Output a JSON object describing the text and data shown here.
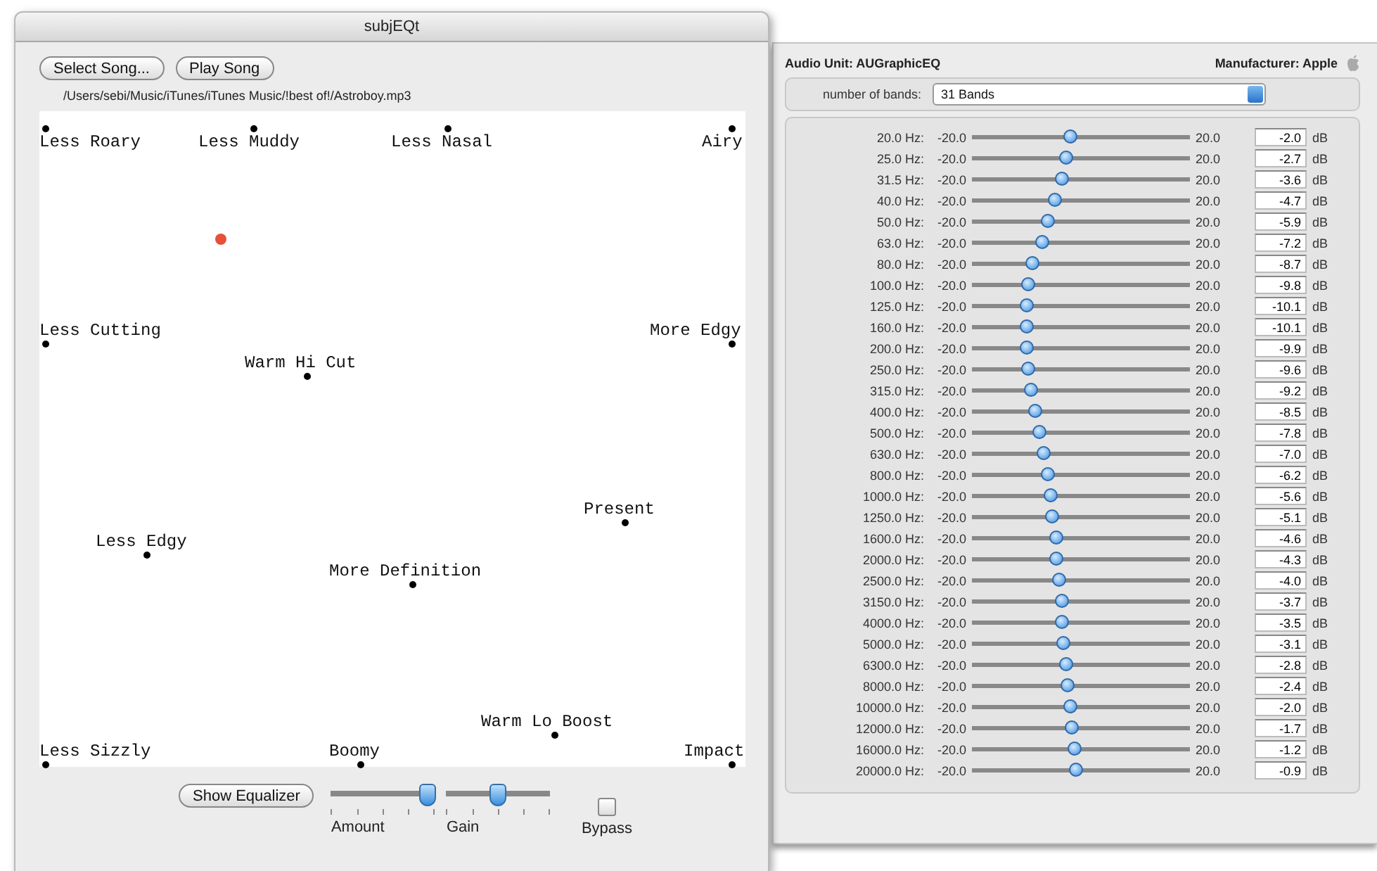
{
  "window": {
    "title": "subjEQt"
  },
  "buttons": [
    "Select Song...",
    "Play Song"
  ],
  "file_path": "/Users/sebi/Music/iTunes/iTunes Music/!best of!/Astroboy.mp3",
  "eq_space": {
    "points": [
      {
        "label": "Less Roary"
      },
      {
        "label": "Less Muddy"
      },
      {
        "label": "Less Nasal"
      },
      {
        "label": "Airy"
      },
      {
        "label": "Less Cutting"
      },
      {
        "label": "More Edgy"
      },
      {
        "label": "Warm Hi Cut"
      },
      {
        "label": "Present"
      },
      {
        "label": "Less Edgy"
      },
      {
        "label": "More Definition"
      },
      {
        "label": "Warm Lo Boost"
      },
      {
        "label": "Less Sizzly"
      },
      {
        "label": "Boomy"
      },
      {
        "label": "Impact"
      }
    ],
    "cursor": {
      "color": "#e8503a"
    }
  },
  "controls": {
    "show_equalizer": "Show Equalizer",
    "sliders": [
      {
        "label": "Amount",
        "level": 0.93
      },
      {
        "label": "Gain",
        "level": 0.5
      }
    ],
    "bypass": {
      "label": "Bypass",
      "checked": false
    }
  },
  "audio_unit": {
    "title": "Audio Unit: AUGraphicEQ",
    "manufacturer": "Manufacturer: Apple",
    "bands_label": "number of bands:",
    "bands_value": "31 Bands",
    "bands": [
      {
        "freq": "20.0 Hz:",
        "min": "-20.0",
        "max": "20.0",
        "value": "-2.0",
        "unit": "dB",
        "level": 0.45
      },
      {
        "freq": "25.0 Hz:",
        "min": "-20.0",
        "max": "20.0",
        "value": "-2.7",
        "unit": "dB",
        "level": 0.43
      },
      {
        "freq": "31.5 Hz:",
        "min": "-20.0",
        "max": "20.0",
        "value": "-3.6",
        "unit": "dB",
        "level": 0.41
      },
      {
        "freq": "40.0 Hz:",
        "min": "-20.0",
        "max": "20.0",
        "value": "-4.7",
        "unit": "dB",
        "level": 0.38
      },
      {
        "freq": "50.0 Hz:",
        "min": "-20.0",
        "max": "20.0",
        "value": "-5.9",
        "unit": "dB",
        "level": 0.35
      },
      {
        "freq": "63.0 Hz:",
        "min": "-20.0",
        "max": "20.0",
        "value": "-7.2",
        "unit": "dB",
        "level": 0.32
      },
      {
        "freq": "80.0 Hz:",
        "min": "-20.0",
        "max": "20.0",
        "value": "-8.7",
        "unit": "dB",
        "level": 0.28
      },
      {
        "freq": "100.0 Hz:",
        "min": "-20.0",
        "max": "20.0",
        "value": "-9.8",
        "unit": "dB",
        "level": 0.26
      },
      {
        "freq": "125.0 Hz:",
        "min": "-20.0",
        "max": "20.0",
        "value": "-10.1",
        "unit": "dB",
        "level": 0.25
      },
      {
        "freq": "160.0 Hz:",
        "min": "-20.0",
        "max": "20.0",
        "value": "-10.1",
        "unit": "dB",
        "level": 0.25
      },
      {
        "freq": "200.0 Hz:",
        "min": "-20.0",
        "max": "20.0",
        "value": "-9.9",
        "unit": "dB",
        "level": 0.25
      },
      {
        "freq": "250.0 Hz:",
        "min": "-20.0",
        "max": "20.0",
        "value": "-9.6",
        "unit": "dB",
        "level": 0.26
      },
      {
        "freq": "315.0 Hz:",
        "min": "-20.0",
        "max": "20.0",
        "value": "-9.2",
        "unit": "dB",
        "level": 0.27
      },
      {
        "freq": "400.0 Hz:",
        "min": "-20.0",
        "max": "20.0",
        "value": "-8.5",
        "unit": "dB",
        "level": 0.29
      },
      {
        "freq": "500.0 Hz:",
        "min": "-20.0",
        "max": "20.0",
        "value": "-7.8",
        "unit": "dB",
        "level": 0.31
      },
      {
        "freq": "630.0 Hz:",
        "min": "-20.0",
        "max": "20.0",
        "value": "-7.0",
        "unit": "dB",
        "level": 0.33
      },
      {
        "freq": "800.0 Hz:",
        "min": "-20.0",
        "max": "20.0",
        "value": "-6.2",
        "unit": "dB",
        "level": 0.35
      },
      {
        "freq": "1000.0 Hz:",
        "min": "-20.0",
        "max": "20.0",
        "value": "-5.6",
        "unit": "dB",
        "level": 0.36
      },
      {
        "freq": "1250.0 Hz:",
        "min": "-20.0",
        "max": "20.0",
        "value": "-5.1",
        "unit": "dB",
        "level": 0.37
      },
      {
        "freq": "1600.0 Hz:",
        "min": "-20.0",
        "max": "20.0",
        "value": "-4.6",
        "unit": "dB",
        "level": 0.39
      },
      {
        "freq": "2000.0 Hz:",
        "min": "-20.0",
        "max": "20.0",
        "value": "-4.3",
        "unit": "dB",
        "level": 0.39
      },
      {
        "freq": "2500.0 Hz:",
        "min": "-20.0",
        "max": "20.0",
        "value": "-4.0",
        "unit": "dB",
        "level": 0.4
      },
      {
        "freq": "3150.0 Hz:",
        "min": "-20.0",
        "max": "20.0",
        "value": "-3.7",
        "unit": "dB",
        "level": 0.41
      },
      {
        "freq": "4000.0 Hz:",
        "min": "-20.0",
        "max": "20.0",
        "value": "-3.5",
        "unit": "dB",
        "level": 0.41
      },
      {
        "freq": "5000.0 Hz:",
        "min": "-20.0",
        "max": "20.0",
        "value": "-3.1",
        "unit": "dB",
        "level": 0.42
      },
      {
        "freq": "6300.0 Hz:",
        "min": "-20.0",
        "max": "20.0",
        "value": "-2.8",
        "unit": "dB",
        "level": 0.43
      },
      {
        "freq": "8000.0 Hz:",
        "min": "-20.0",
        "max": "20.0",
        "value": "-2.4",
        "unit": "dB",
        "level": 0.44
      },
      {
        "freq": "10000.0 Hz:",
        "min": "-20.0",
        "max": "20.0",
        "value": "-2.0",
        "unit": "dB",
        "level": 0.45
      },
      {
        "freq": "12000.0 Hz:",
        "min": "-20.0",
        "max": "20.0",
        "value": "-1.7",
        "unit": "dB",
        "level": 0.46
      },
      {
        "freq": "16000.0 Hz:",
        "min": "-20.0",
        "max": "20.0",
        "value": "-1.2",
        "unit": "dB",
        "level": 0.47
      },
      {
        "freq": "20000.0 Hz:",
        "min": "-20.0",
        "max": "20.0",
        "value": "-0.9",
        "unit": "dB",
        "level": 0.48
      }
    ]
  }
}
